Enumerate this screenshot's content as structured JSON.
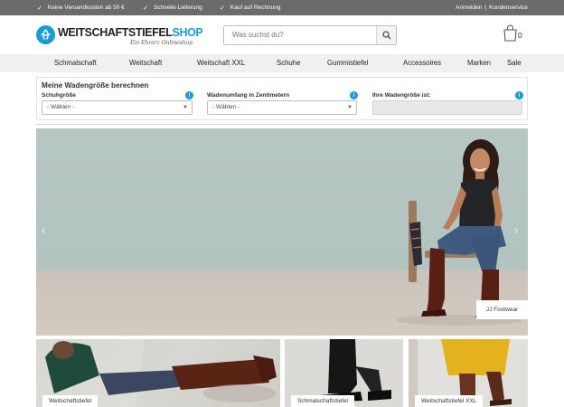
{
  "topbar": {
    "usps": [
      "Keine Versandkosten ab 50 €",
      "Schnelle Lieferung",
      "Kauf auf Rechnung"
    ],
    "login_label": "Anmelden",
    "separator": "|",
    "service_label": "Kundenservice"
  },
  "header": {
    "logo_main": "WEITSCHAFTSTIEFEL",
    "logo_accent": "SHOP",
    "logo_sub": "Ein Ehrarz Onlineshop",
    "search_placeholder": "Was suchst du?",
    "cart_count": "0"
  },
  "nav": {
    "items": [
      "Schmalschaft",
      "Weitschaft",
      "Weitschaft XXL",
      "Schuhe",
      "Gummistiefel",
      "Accessoires",
      "Marken",
      "Sale"
    ]
  },
  "calculator": {
    "title": "Meine Wadengröße berechnen",
    "shoe_size_label": "Schuhgröße",
    "shoe_size_value": "- Wählen -",
    "calf_label": "Wadenumfang in Zentimetern",
    "calf_value": "- Wählen -",
    "result_label": "Ihre Wadengröße ist:",
    "info_glyph": "i"
  },
  "hero": {
    "caption": "JJ Footwear",
    "prev_glyph": "‹",
    "next_glyph": "›"
  },
  "tiles": [
    {
      "label": "Weitschaftstiefel"
    },
    {
      "label": "Schmalschaftstiefel"
    },
    {
      "label": "Weitschaftstiefel XXL"
    }
  ],
  "colors": {
    "brand_blue": "#1a9bd7",
    "topbar": "#6b6b6b",
    "nav_bg": "#f0f0f0"
  },
  "icons": [
    "check-icon",
    "search-icon",
    "cart-icon",
    "info-icon",
    "chevron-down-icon",
    "chevron-left-icon",
    "chevron-right-icon"
  ]
}
